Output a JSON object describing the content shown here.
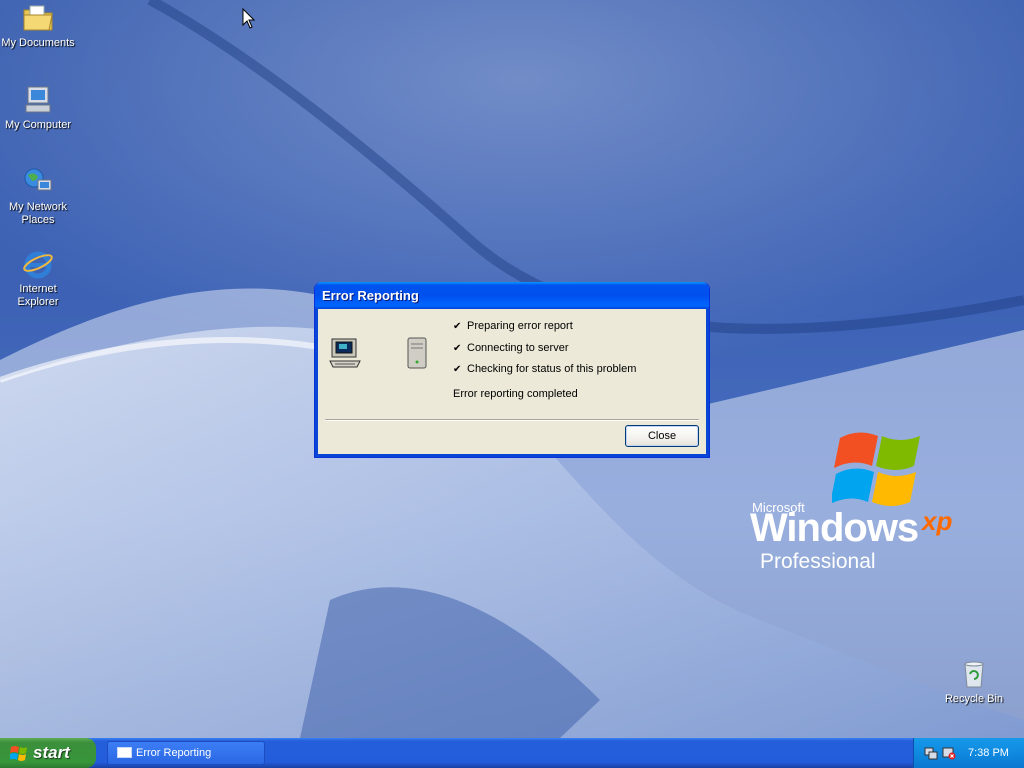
{
  "desktop": {
    "icons": [
      {
        "label": "My Documents"
      },
      {
        "label": "My Computer"
      },
      {
        "label": "My Network Places"
      },
      {
        "label": "Internet Explorer"
      },
      {
        "label": "Recycle Bin"
      }
    ],
    "logo": {
      "microsoft": "Microsoft",
      "windows": "Windows",
      "xp": "xp",
      "edition": "Professional"
    }
  },
  "dialog": {
    "title": "Error Reporting",
    "steps": [
      {
        "label": "Preparing error report",
        "done": true
      },
      {
        "label": "Connecting to server",
        "done": true
      },
      {
        "label": "Checking for status of this problem",
        "done": true
      }
    ],
    "check_glyph": "✔",
    "status": "Error reporting completed",
    "close_label": "Close"
  },
  "taskbar": {
    "start_label": "start",
    "items": [
      {
        "label": "Error Reporting"
      }
    ],
    "clock": "7:38 PM"
  },
  "colors": {
    "title_bar": "#0055ea",
    "taskbar": "#245edb",
    "start_button": "#3c8f3b",
    "dialog_face": "#ece9d8"
  }
}
